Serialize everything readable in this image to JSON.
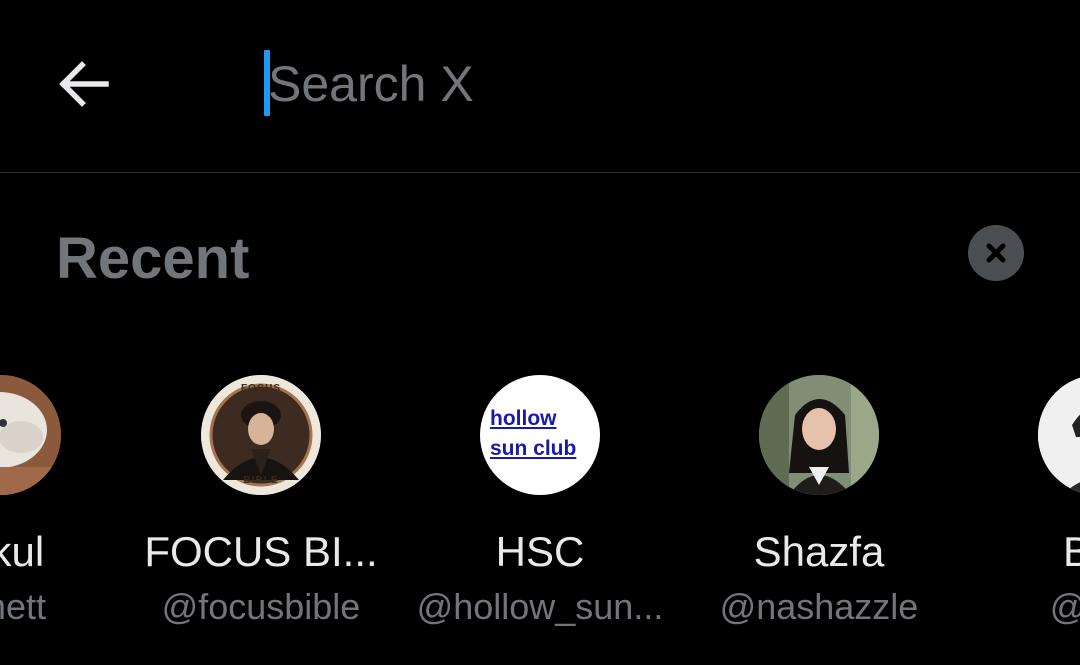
{
  "search": {
    "placeholder": "Search X"
  },
  "recent": {
    "title": "Recent"
  },
  "accounts": [
    {
      "name": "ttikul",
      "handle": "umett"
    },
    {
      "name": "FOCUS BI...",
      "handle": "@focusbible",
      "avatar_text_top": "FOCUS",
      "avatar_text_bottom": "BIBLE"
    },
    {
      "name": "HSC",
      "handle": "@hollow_sun...",
      "avatar_text_line1": "hollow",
      "avatar_text_line2": "sun club"
    },
    {
      "name": "Shazfa",
      "handle": "@nashazzle"
    },
    {
      "name": "BRI",
      "handle": "@brig"
    }
  ],
  "icons": {
    "back": "arrow-left-icon",
    "clear": "close-icon"
  },
  "colors": {
    "background": "#000000",
    "text": "#e7e9ea",
    "secondary": "#71767b",
    "accent": "#1d9bf0"
  }
}
